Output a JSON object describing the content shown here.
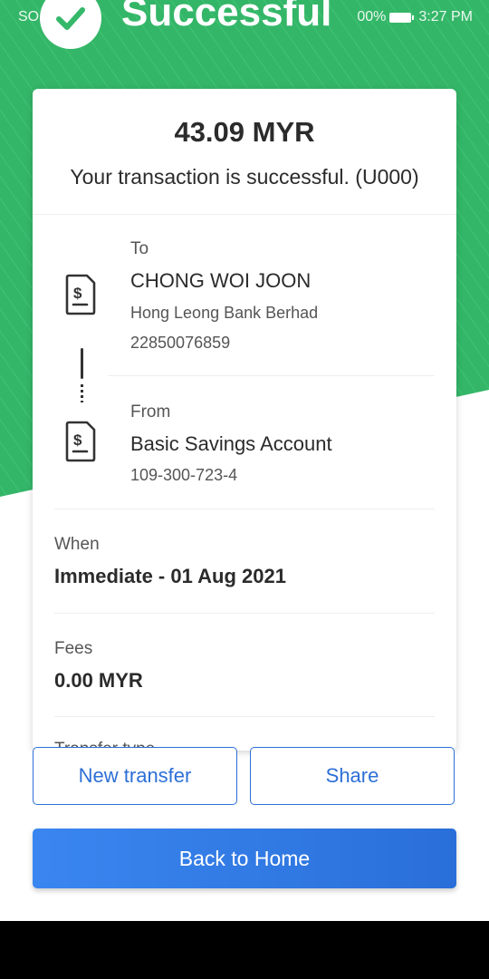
{
  "status_bar": {
    "carrier": "SO",
    "battery": "00%",
    "time": "3:27 PM"
  },
  "header": {
    "title": "Successful"
  },
  "receipt": {
    "amount": "43.09  MYR",
    "message": "Your transaction is successful. (U000)",
    "to": {
      "label": "To",
      "name": "CHONG WOI JOON",
      "bank": "Hong Leong Bank Berhad",
      "account": "22850076859"
    },
    "from": {
      "label": "From",
      "name": "Basic Savings Account",
      "account": "109-300-723-4"
    },
    "when": {
      "label": "When",
      "value": "Immediate - 01 Aug 2021"
    },
    "fees": {
      "label": "Fees",
      "value": "0.00 MYR"
    },
    "partial_label": "Transfer type"
  },
  "actions": {
    "new_transfer": "New transfer",
    "share": "Share",
    "back_home": "Back to Home"
  },
  "colors": {
    "green": "#35b86a",
    "accent_blue": "#2d6fd6"
  }
}
